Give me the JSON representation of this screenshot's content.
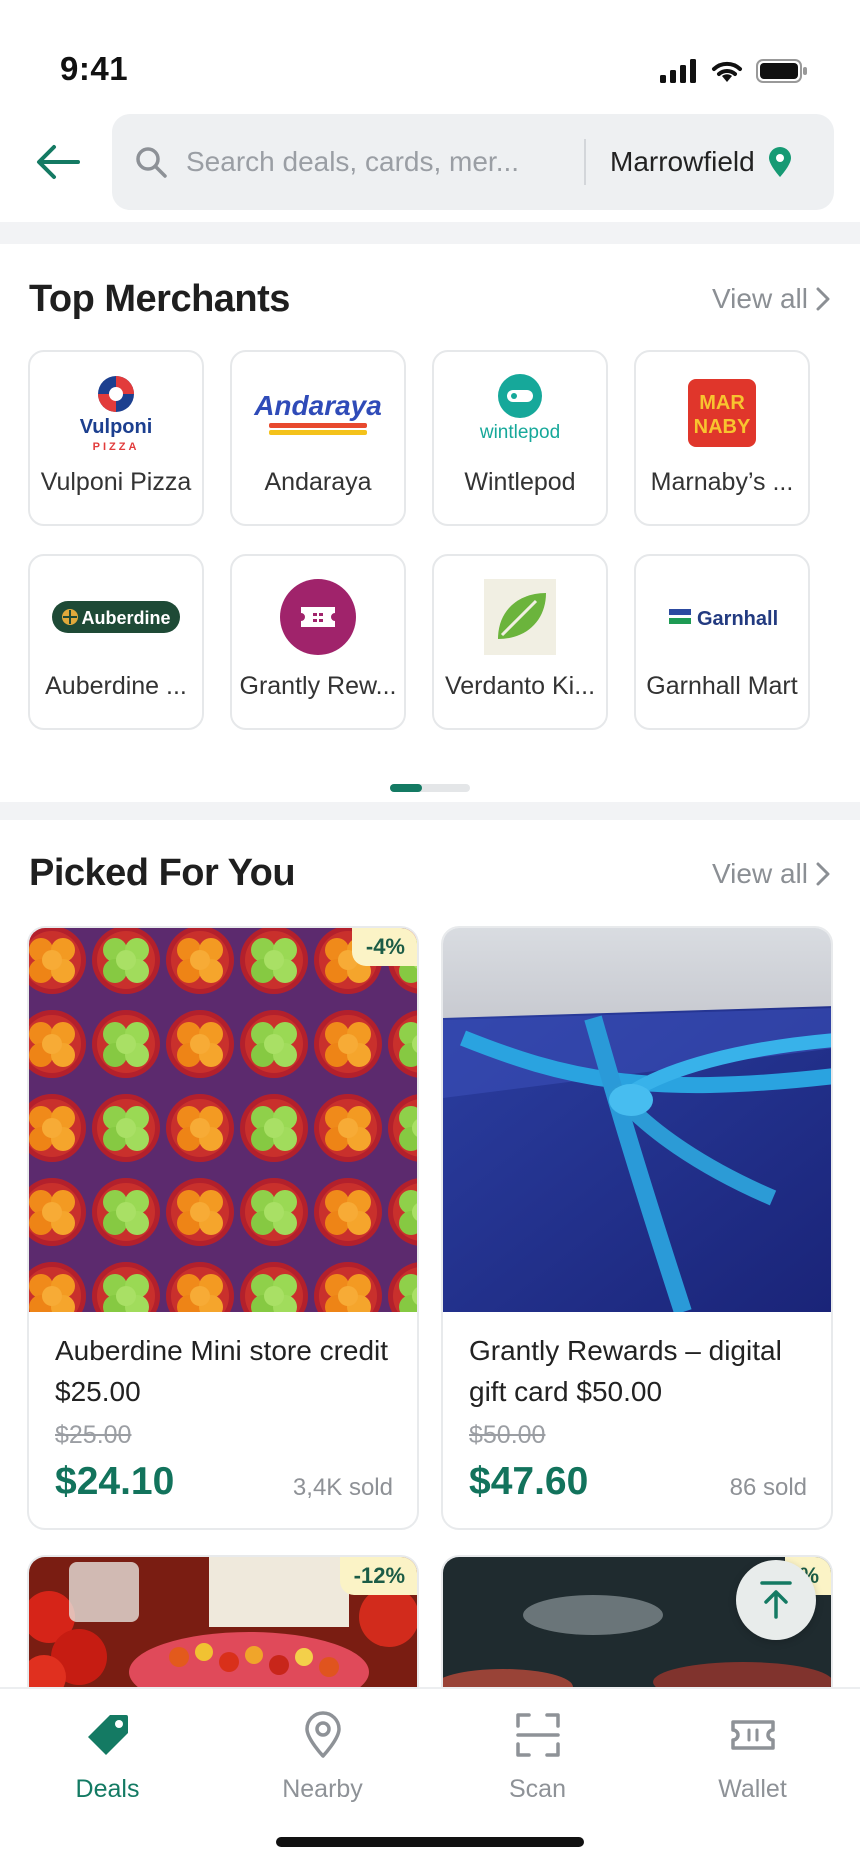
{
  "status": {
    "time": "9:41"
  },
  "header": {
    "search_placeholder": "Search deals, cards, mer...",
    "location": "Marrowfield"
  },
  "top_merchants": {
    "title": "Top Merchants",
    "view_all": "View all",
    "items": [
      {
        "name": "Vulponi Pizza",
        "logo_text": "Vulponi",
        "logo_sub": "PIZZA"
      },
      {
        "name": "Andaraya",
        "logo_text": "Andaraya"
      },
      {
        "name": "Wintlepod",
        "logo_text": "wintlepod"
      },
      {
        "name": "Marnaby’s ...",
        "logo_text": "MAR NABY"
      },
      {
        "name": "Auberdine ...",
        "logo_text": "Auberdine"
      },
      {
        "name": "Grantly Rew...",
        "logo_text": ""
      },
      {
        "name": "Verdanto Ki...",
        "logo_text": ""
      },
      {
        "name": "Garnhall Mart",
        "logo_text": "Garnhall"
      }
    ]
  },
  "picked_for_you": {
    "title": "Picked For You",
    "view_all": "View all",
    "deals": [
      {
        "title": "Auberdine Mini store credit $25.00",
        "old_price": "$25.00",
        "price": "$24.10",
        "sold": "3,4K sold",
        "discount": "-4%"
      },
      {
        "title": "Grantly Rewards – digital gift card $50.00",
        "old_price": "$50.00",
        "price": "$47.60",
        "sold": "86 sold",
        "discount": ""
      },
      {
        "discount": "-12%"
      },
      {
        "discount": "%"
      }
    ]
  },
  "nav": {
    "items": [
      {
        "label": "Deals",
        "icon": "tag-icon",
        "active": true
      },
      {
        "label": "Nearby",
        "icon": "location-pin-icon",
        "active": false
      },
      {
        "label": "Scan",
        "icon": "scan-icon",
        "active": false
      },
      {
        "label": "Wallet",
        "icon": "ticket-icon",
        "active": false
      }
    ]
  },
  "colors": {
    "brand": "#137a63",
    "badge_bg": "#fbf3c6"
  }
}
